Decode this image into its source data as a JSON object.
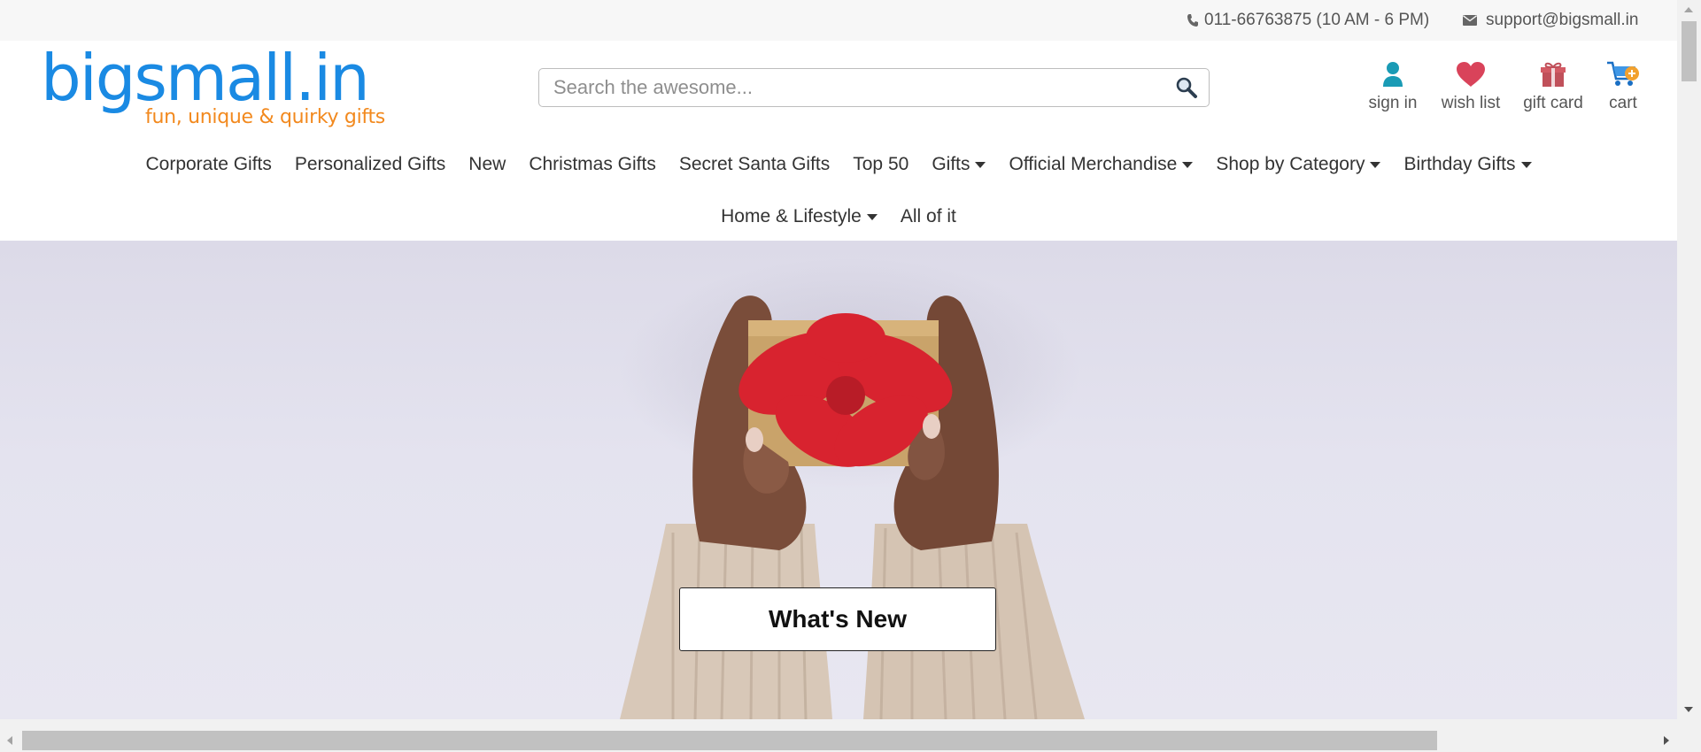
{
  "topbar": {
    "phone": "011-66763875 (10 AM - 6 PM)",
    "email": "support@bigsmall.in",
    "phone_icon": "phone-icon",
    "email_icon": "envelope-icon"
  },
  "logo": {
    "text": "bigsmall.in",
    "tagline": "fun, unique & quirky gifts"
  },
  "search": {
    "placeholder": "Search the awesome...",
    "value": "",
    "icon": "magnifier-icon"
  },
  "header_icons": [
    {
      "label": "sign in",
      "icon": "user-icon"
    },
    {
      "label": "wish list",
      "icon": "heart-icon"
    },
    {
      "label": "gift card",
      "icon": "gift-icon"
    },
    {
      "label": "cart",
      "icon": "cart-icon"
    }
  ],
  "nav": {
    "row1": [
      {
        "label": "Corporate Gifts",
        "dropdown": false
      },
      {
        "label": "Personalized Gifts",
        "dropdown": false
      },
      {
        "label": "New",
        "dropdown": false
      },
      {
        "label": "Christmas Gifts",
        "dropdown": false
      },
      {
        "label": "Secret Santa Gifts",
        "dropdown": false
      },
      {
        "label": "Top 50",
        "dropdown": false
      },
      {
        "label": "Gifts",
        "dropdown": true
      },
      {
        "label": "Official Merchandise",
        "dropdown": true
      },
      {
        "label": "Shop by Category",
        "dropdown": true
      },
      {
        "label": "Birthday Gifts",
        "dropdown": true
      }
    ],
    "row2": [
      {
        "label": "Home & Lifestyle",
        "dropdown": true
      },
      {
        "label": "All of it",
        "dropdown": false
      }
    ]
  },
  "hero": {
    "cta_label": "What's New"
  },
  "colors": {
    "logo_blue": "#1a8ae3",
    "logo_orange": "#f2891e",
    "user_icon": "#1a9bb5",
    "heart_icon": "#d9435a",
    "gift_icon": "#c0505a",
    "ribbon_red": "#d8232f",
    "hero_bg": "#e2e1ee"
  }
}
